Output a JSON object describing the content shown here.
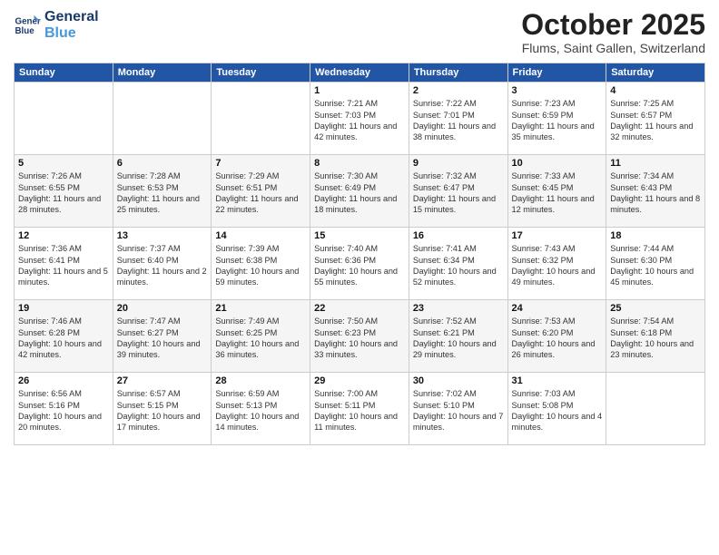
{
  "logo": {
    "line1": "General",
    "line2": "Blue"
  },
  "title": "October 2025",
  "subtitle": "Flums, Saint Gallen, Switzerland",
  "days_of_week": [
    "Sunday",
    "Monday",
    "Tuesday",
    "Wednesday",
    "Thursday",
    "Friday",
    "Saturday"
  ],
  "weeks": [
    [
      {
        "day": "",
        "info": ""
      },
      {
        "day": "",
        "info": ""
      },
      {
        "day": "",
        "info": ""
      },
      {
        "day": "1",
        "info": "Sunrise: 7:21 AM\nSunset: 7:03 PM\nDaylight: 11 hours and 42 minutes."
      },
      {
        "day": "2",
        "info": "Sunrise: 7:22 AM\nSunset: 7:01 PM\nDaylight: 11 hours and 38 minutes."
      },
      {
        "day": "3",
        "info": "Sunrise: 7:23 AM\nSunset: 6:59 PM\nDaylight: 11 hours and 35 minutes."
      },
      {
        "day": "4",
        "info": "Sunrise: 7:25 AM\nSunset: 6:57 PM\nDaylight: 11 hours and 32 minutes."
      }
    ],
    [
      {
        "day": "5",
        "info": "Sunrise: 7:26 AM\nSunset: 6:55 PM\nDaylight: 11 hours and 28 minutes."
      },
      {
        "day": "6",
        "info": "Sunrise: 7:28 AM\nSunset: 6:53 PM\nDaylight: 11 hours and 25 minutes."
      },
      {
        "day": "7",
        "info": "Sunrise: 7:29 AM\nSunset: 6:51 PM\nDaylight: 11 hours and 22 minutes."
      },
      {
        "day": "8",
        "info": "Sunrise: 7:30 AM\nSunset: 6:49 PM\nDaylight: 11 hours and 18 minutes."
      },
      {
        "day": "9",
        "info": "Sunrise: 7:32 AM\nSunset: 6:47 PM\nDaylight: 11 hours and 15 minutes."
      },
      {
        "day": "10",
        "info": "Sunrise: 7:33 AM\nSunset: 6:45 PM\nDaylight: 11 hours and 12 minutes."
      },
      {
        "day": "11",
        "info": "Sunrise: 7:34 AM\nSunset: 6:43 PM\nDaylight: 11 hours and 8 minutes."
      }
    ],
    [
      {
        "day": "12",
        "info": "Sunrise: 7:36 AM\nSunset: 6:41 PM\nDaylight: 11 hours and 5 minutes."
      },
      {
        "day": "13",
        "info": "Sunrise: 7:37 AM\nSunset: 6:40 PM\nDaylight: 11 hours and 2 minutes."
      },
      {
        "day": "14",
        "info": "Sunrise: 7:39 AM\nSunset: 6:38 PM\nDaylight: 10 hours and 59 minutes."
      },
      {
        "day": "15",
        "info": "Sunrise: 7:40 AM\nSunset: 6:36 PM\nDaylight: 10 hours and 55 minutes."
      },
      {
        "day": "16",
        "info": "Sunrise: 7:41 AM\nSunset: 6:34 PM\nDaylight: 10 hours and 52 minutes."
      },
      {
        "day": "17",
        "info": "Sunrise: 7:43 AM\nSunset: 6:32 PM\nDaylight: 10 hours and 49 minutes."
      },
      {
        "day": "18",
        "info": "Sunrise: 7:44 AM\nSunset: 6:30 PM\nDaylight: 10 hours and 45 minutes."
      }
    ],
    [
      {
        "day": "19",
        "info": "Sunrise: 7:46 AM\nSunset: 6:28 PM\nDaylight: 10 hours and 42 minutes."
      },
      {
        "day": "20",
        "info": "Sunrise: 7:47 AM\nSunset: 6:27 PM\nDaylight: 10 hours and 39 minutes."
      },
      {
        "day": "21",
        "info": "Sunrise: 7:49 AM\nSunset: 6:25 PM\nDaylight: 10 hours and 36 minutes."
      },
      {
        "day": "22",
        "info": "Sunrise: 7:50 AM\nSunset: 6:23 PM\nDaylight: 10 hours and 33 minutes."
      },
      {
        "day": "23",
        "info": "Sunrise: 7:52 AM\nSunset: 6:21 PM\nDaylight: 10 hours and 29 minutes."
      },
      {
        "day": "24",
        "info": "Sunrise: 7:53 AM\nSunset: 6:20 PM\nDaylight: 10 hours and 26 minutes."
      },
      {
        "day": "25",
        "info": "Sunrise: 7:54 AM\nSunset: 6:18 PM\nDaylight: 10 hours and 23 minutes."
      }
    ],
    [
      {
        "day": "26",
        "info": "Sunrise: 6:56 AM\nSunset: 5:16 PM\nDaylight: 10 hours and 20 minutes."
      },
      {
        "day": "27",
        "info": "Sunrise: 6:57 AM\nSunset: 5:15 PM\nDaylight: 10 hours and 17 minutes."
      },
      {
        "day": "28",
        "info": "Sunrise: 6:59 AM\nSunset: 5:13 PM\nDaylight: 10 hours and 14 minutes."
      },
      {
        "day": "29",
        "info": "Sunrise: 7:00 AM\nSunset: 5:11 PM\nDaylight: 10 hours and 11 minutes."
      },
      {
        "day": "30",
        "info": "Sunrise: 7:02 AM\nSunset: 5:10 PM\nDaylight: 10 hours and 7 minutes."
      },
      {
        "day": "31",
        "info": "Sunrise: 7:03 AM\nSunset: 5:08 PM\nDaylight: 10 hours and 4 minutes."
      },
      {
        "day": "",
        "info": ""
      }
    ]
  ]
}
